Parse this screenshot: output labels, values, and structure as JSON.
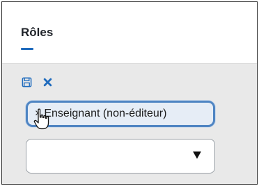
{
  "header": {
    "title": "Rôles"
  },
  "toolbar": {
    "save_icon": "floppy-disk-icon",
    "cancel_icon": "x-icon"
  },
  "tags": [
    {
      "remove_glyph": "×",
      "label": "Enseignant (non-éditeur)"
    }
  ],
  "select": {
    "value": "",
    "arrow_icon": "triangle-down-icon"
  },
  "colors": {
    "accent": "#1f6bbd",
    "tag_border": "#4f85c3",
    "panel_bg": "#e9e9e9"
  }
}
